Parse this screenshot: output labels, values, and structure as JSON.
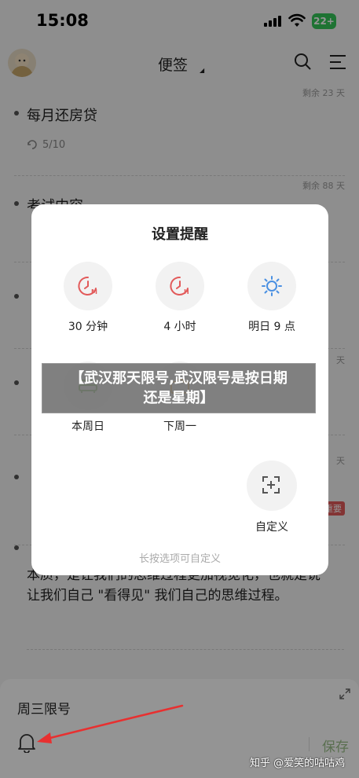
{
  "status": {
    "time": "15:08",
    "battery": "22+"
  },
  "app": {
    "title": "便签"
  },
  "notes": [
    {
      "remain": "剩余 23 天",
      "title": "每月还房贷",
      "sub": "5/10"
    },
    {
      "remain": "剩余 88 天",
      "title": "考试内容"
    }
  ],
  "background": {
    "remain_left": [
      "天",
      "天"
    ],
    "tag": "重要",
    "paragraph_line1": "本质，是让我们的思维过程更加视觉化，也就是说",
    "paragraph_line2": "让我们自己 \"看得见\" 我们自己的思维过程。"
  },
  "dialog": {
    "title": "设置提醒",
    "options": [
      {
        "label": "30 分钟",
        "icon": "clock-m-icon"
      },
      {
        "label": "4 小时",
        "icon": "clock-h-icon"
      },
      {
        "label": "明日 9 点",
        "icon": "sun-icon"
      },
      {
        "label": "本周日",
        "icon": "sofa-icon"
      },
      {
        "label": "下周一",
        "icon": "briefcase-icon"
      },
      {
        "label": "自定义",
        "icon": "custom-plus-icon"
      }
    ],
    "hint": "长按选项可自定义"
  },
  "banner": {
    "line1": "【武汉那天限号,武汉限号是按日期",
    "line2": "还是星期】"
  },
  "editor": {
    "text": "周三限号",
    "save": "保存"
  },
  "watermark": "知乎 @爱笑的咕咕鸡",
  "colors": {
    "accent_red": "#e25a5a",
    "save_green": "#9cc08a",
    "sun_blue": "#4a90e2"
  }
}
